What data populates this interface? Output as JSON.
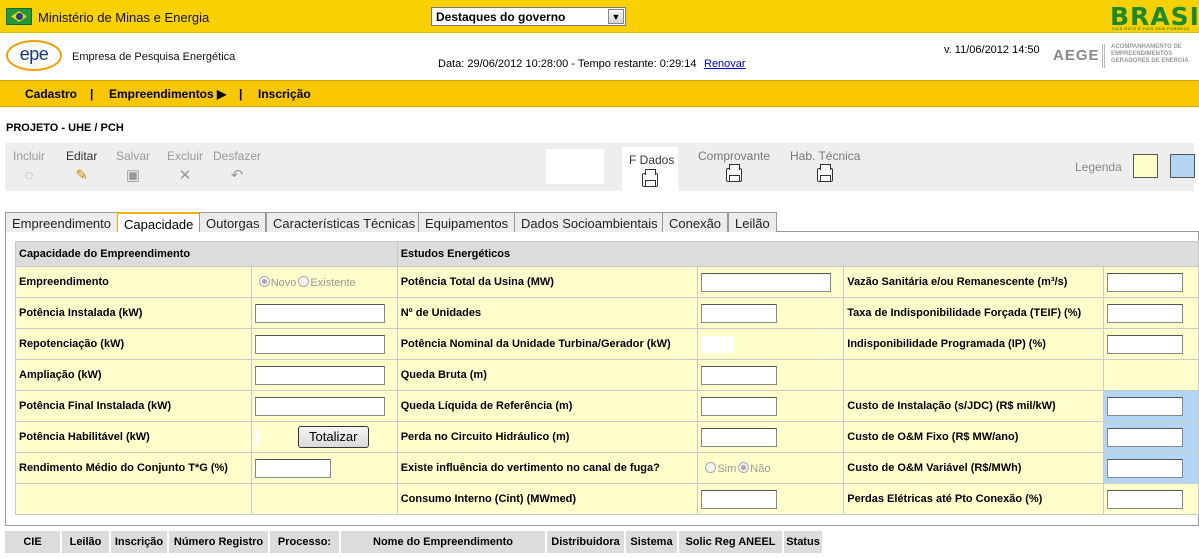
{
  "gov": {
    "ministry": "Ministério de Minas e Energia",
    "select_value": "Destaques do governo",
    "brasil_logo": "BRASIL",
    "brasil_tagline": "PAÍS RICO É PAÍS SEM POBREZA"
  },
  "header": {
    "company": "Empresa de Pesquisa Energética",
    "logo_text": "epe",
    "date_text": "Data: 29/06/2012 10:28:00  - Tempo restante:  0:29:14",
    "renew_link": "Renovar",
    "version": "v. 11/06/2012 14:50",
    "aege": "AEGE",
    "aege_sub": "ACOMPANHAMENTO DE EMPREENDIMENTOS GERADORES DE ENERGIA"
  },
  "menu": {
    "items": [
      "Cadastro",
      "Empreendimentos ▶",
      "Inscrição"
    ],
    "sep": "|"
  },
  "project_title": "PROJETO - UHE / PCH",
  "toolbar": {
    "incluir": "Incluir",
    "editar": "Editar",
    "salvar": "Salvar",
    "excluir": "Excluir",
    "desfazer": "Desfazer",
    "fdados": "F Dados",
    "comprovante": "Comprovante",
    "habtecnica": "Hab. Técnica",
    "legenda": "Legenda",
    "colors": {
      "legend_yellow": "#ffffcc",
      "legend_blue": "#b3d6f5",
      "accent": "#f9c700"
    }
  },
  "tabs": [
    "Empreendimento",
    "Capacidade",
    "Outorgas",
    "Características Técnicas",
    "Equipamentos",
    "Dados Socioambientais",
    "Conexão",
    "Leilão"
  ],
  "grid": {
    "h_left": "Capacidade do Empreendimento",
    "h_right": "Estudos Energéticos",
    "left": [
      "Empreendimento",
      "Potência Instalada (kW)",
      "Repotenciação (kW)",
      "Ampliação (kW)",
      "Potência Final Instalada (kW)",
      "Potência Habilitável (kW)",
      "Rendimento Médio do Conjunto T*G (%)"
    ],
    "mid": [
      "Potência Total da Usina (MW)",
      "Nº de Unidades",
      "Potência Nominal da Unidade Turbina/Gerador (kW)",
      "Queda Bruta (m)",
      "Queda Líquida de Referência (m)",
      "Perda no Circuito Hidráulico (m)",
      "Existe influência do vertimento no canal de fuga?",
      "Consumo Interno (Cint) (MWmed)"
    ],
    "right": [
      "Vazão Sanitária e/ou Remanescente (m³/s)",
      "Taxa de Indisponibilidade Forçada (TEIF) (%)",
      "Indisponibilidade Programada (IP) (%)",
      "",
      "Custo de Instalação (s/JDC) (R$ mil/kW)",
      "Custo de O&M Fixo (R$ MW/ano)",
      "Custo de O&M Variável (R$/MWh)",
      "Perdas Elétricas até Pto Conexão (%)"
    ],
    "radio_novo": "Novo",
    "radio_existente": "Existente",
    "radio_sim": "Sim",
    "radio_nao": "Não",
    "totalizar": "Totalizar"
  },
  "bottom_cols": [
    "CIE",
    "Leilão",
    "Inscrição",
    "Número Registro",
    "Processo:",
    "Nome do Empreendimento",
    "Distribuidora",
    "Sistema",
    "Solic Reg ANEEL",
    "Status"
  ]
}
